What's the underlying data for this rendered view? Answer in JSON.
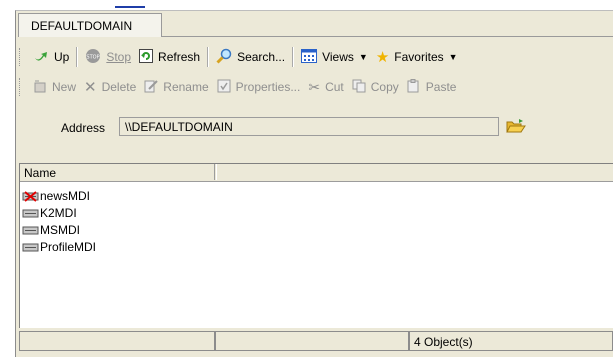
{
  "tab": {
    "label": "DEFAULTDOMAIN"
  },
  "toolbar1": {
    "up": "Up",
    "stop": "Stop",
    "refresh": "Refresh",
    "search": "Search...",
    "views": "Views",
    "favorites": "Favorites"
  },
  "toolbar2": {
    "new": "New",
    "delete": "Delete",
    "rename": "Rename",
    "properties": "Properties...",
    "cut": "Cut",
    "copy": "Copy",
    "paste": "Paste"
  },
  "address": {
    "label": "Address",
    "value": "\\\\DEFAULTDOMAIN"
  },
  "list": {
    "columns": [
      "Name"
    ],
    "items": [
      {
        "name": "newsMDI",
        "icon": "drive-disconnected-icon"
      },
      {
        "name": "K2MDI",
        "icon": "drive-icon"
      },
      {
        "name": "MSMDI",
        "icon": "drive-icon"
      },
      {
        "name": "ProfileMDI",
        "icon": "drive-icon"
      }
    ]
  },
  "status": {
    "count": "4 Object(s)"
  }
}
